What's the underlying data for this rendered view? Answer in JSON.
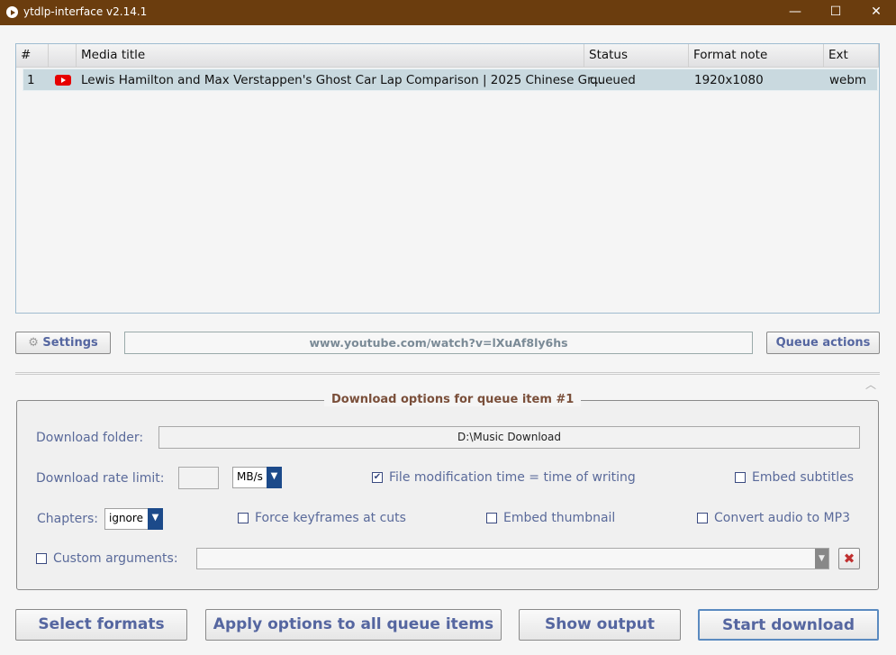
{
  "window": {
    "title": "ytdlp-interface v2.14.1",
    "minimize": "—",
    "maximize": "☐",
    "close": "✕"
  },
  "table": {
    "headers": [
      "#",
      "",
      "Media title",
      "Status",
      "Format note",
      "Ext"
    ],
    "rows": [
      {
        "num": "1",
        "icon": "youtube-icon",
        "title": "Lewis Hamilton and Max Verstappen's Ghost Car Lap Comparison | 2025 Chinese Gr...",
        "status": "queued",
        "format_note": "1920x1080",
        "ext": "webm"
      }
    ]
  },
  "toolbar": {
    "settings": "Settings",
    "url": "www.youtube.com/watch?v=lXuAf8ly6hs",
    "queue_actions": "Queue actions"
  },
  "options": {
    "legend": "Download options for queue item #1",
    "download_folder_label": "Download folder:",
    "download_folder": "D:\\Music Download",
    "rate_limit_label": "Download rate limit:",
    "rate_limit": "",
    "rate_unit": "MB/s",
    "file_mod_time": {
      "label": "File modification time = time of writing",
      "checked": true
    },
    "embed_subtitles": {
      "label": "Embed subtitles",
      "checked": false
    },
    "chapters_label": "Chapters:",
    "chapters": "ignore",
    "force_keyframes": {
      "label": "Force keyframes at cuts",
      "checked": false
    },
    "embed_thumbnail": {
      "label": "Embed thumbnail",
      "checked": false
    },
    "convert_mp3": {
      "label": "Convert audio to MP3",
      "checked": false
    },
    "custom_args": {
      "label": "Custom arguments:",
      "checked": false,
      "value": ""
    }
  },
  "buttons": {
    "select_formats": "Select formats",
    "apply_all": "Apply options to all queue items",
    "show_output": "Show output",
    "start_download": "Start download"
  },
  "colors": {
    "titlebar": "#6b3d0e",
    "row_selected": "#c9d9df",
    "legend": "#7a4f3a",
    "button_text": "#5566a0"
  }
}
